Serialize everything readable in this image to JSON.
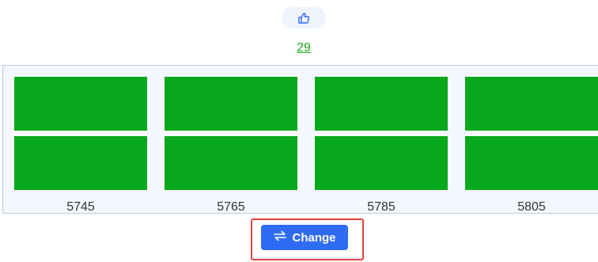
{
  "like_button": {
    "icon": "thumbs-up-icon",
    "bg_color": "#eef3fc"
  },
  "count": "29",
  "channels": [
    {
      "label": "5745"
    },
    {
      "label": "5765"
    },
    {
      "label": "5785"
    },
    {
      "label": "5805"
    }
  ],
  "tile_color": "#0aa81c",
  "change_button": {
    "label": "Change",
    "icon": "swap-arrows-icon",
    "color": "#2f6cf6",
    "highlight_color": "#e2413c"
  }
}
